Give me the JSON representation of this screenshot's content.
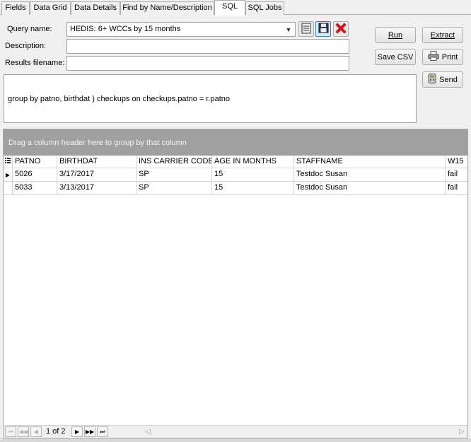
{
  "tabs": [
    {
      "label": "Fields"
    },
    {
      "label": "Data Grid"
    },
    {
      "label": "Data Details"
    },
    {
      "label": "Find by Name/Description"
    },
    {
      "label": "SQL"
    },
    {
      "label": "SQL Jobs"
    }
  ],
  "form": {
    "query_name_label": "Query name:",
    "query_name_value": "HEDIS: 6+ WCCs by 15 months",
    "description_label": "Description:",
    "description_value": "",
    "results_filename_label": "Results filename:",
    "results_filename_value": ""
  },
  "buttons": {
    "run": "Run",
    "extract": "Extract",
    "save_csv": "Save CSV",
    "print": "Print",
    "send": "Send"
  },
  "sql_text": "group by patno, birthdat ) checkups on checkups.patno = r.patno",
  "grid": {
    "group_panel_text": "Drag a column header here to group by that column",
    "columns": [
      "PATNO",
      "BIRTHDAT",
      "INS CARRIER CODE",
      "AGE IN MONTHS",
      "STAFFNAME",
      "W15"
    ],
    "rows": [
      [
        "5026",
        "3/17/2017",
        "SP",
        "15",
        "Testdoc Susan",
        "fail"
      ],
      [
        "5033",
        "3/13/2017",
        "SP",
        "15",
        "Testdoc Susan",
        "fail"
      ]
    ],
    "page_info": "1 of 2"
  }
}
